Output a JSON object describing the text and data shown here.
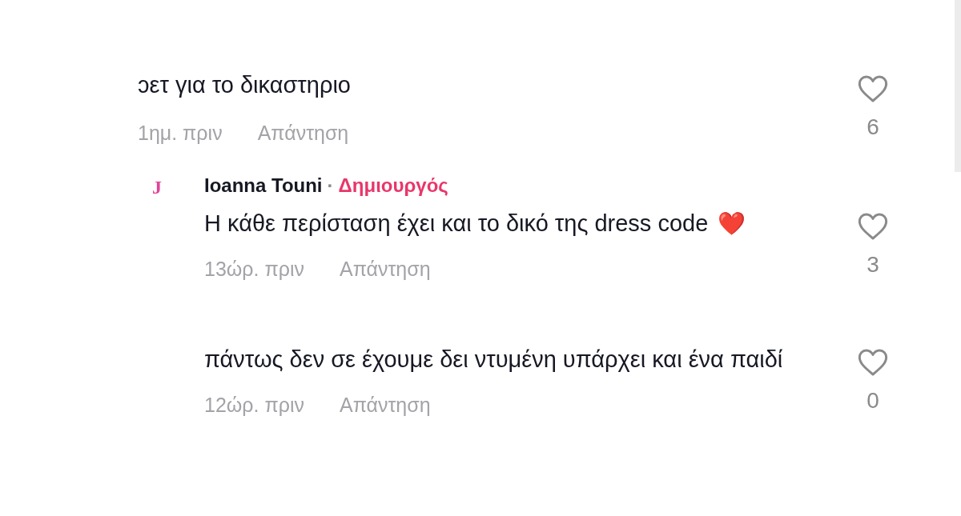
{
  "comments": [
    {
      "text": "ɔετ για το δικαστηριο",
      "time": "1ημ. πριν",
      "reply_label": "Απάντηση",
      "likes": "6",
      "children": [
        {
          "avatar_letter": "J",
          "author": "Ioanna Touni",
          "separator": "·",
          "badge": "Δημιουργός",
          "text": "Η κάθε περίσταση έχει και το δικό της dress code",
          "emoji": "❤️",
          "time": "13ώρ. πριν",
          "reply_label": "Απάντηση",
          "likes": "3"
        },
        {
          "text": "πάντως δεν σε έχουμε δει ντυμένη υπάρχει και ένα παιδί",
          "time": "12ώρ. πριν",
          "reply_label": "Απάντηση",
          "likes": "0"
        }
      ]
    }
  ]
}
